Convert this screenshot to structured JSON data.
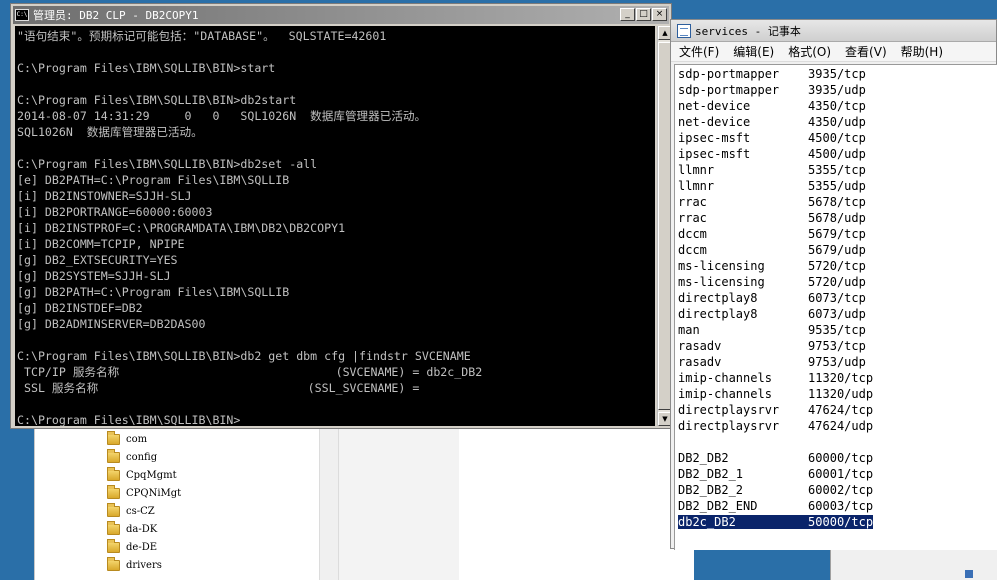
{
  "explorer": {
    "folders": [
      "com",
      "config",
      "CpqMgmt",
      "CPQNiMgt",
      "cs-CZ",
      "da-DK",
      "de-DE",
      "drivers"
    ]
  },
  "console": {
    "title": "管理员: DB2 CLP - DB2COPY1",
    "lines": [
      "\"语句结束\"。预期标记可能包括：\"DATABASE\"。  SQLSTATE=42601",
      "",
      "C:\\Program Files\\IBM\\SQLLIB\\BIN>start",
      "",
      "C:\\Program Files\\IBM\\SQLLIB\\BIN>db2start",
      "2014-08-07 14:31:29     0   0   SQL1026N  数据库管理器已活动。",
      "SQL1026N  数据库管理器已活动。",
      "",
      "C:\\Program Files\\IBM\\SQLLIB\\BIN>db2set -all",
      "[e] DB2PATH=C:\\Program Files\\IBM\\SQLLIB",
      "[i] DB2INSTOWNER=SJJH-SLJ",
      "[i] DB2PORTRANGE=60000:60003",
      "[i] DB2INSTPROF=C:\\PROGRAMDATA\\IBM\\DB2\\DB2COPY1",
      "[i] DB2COMM=TCPIP, NPIPE",
      "[g] DB2_EXTSECURITY=YES",
      "[g] DB2SYSTEM=SJJH-SLJ",
      "[g] DB2PATH=C:\\Program Files\\IBM\\SQLLIB",
      "[g] DB2INSTDEF=DB2",
      "[g] DB2ADMINSERVER=DB2DAS00",
      "",
      "C:\\Program Files\\IBM\\SQLLIB\\BIN>db2 get dbm cfg |findstr SVCENAME",
      " TCP/IP 服务名称                               (SVCENAME) = db2c_DB2",
      " SSL 服务名称                              (SSL_SVCENAME) =",
      "",
      "C:\\Program Files\\IBM\\SQLLIB\\BIN>"
    ]
  },
  "notepad": {
    "title": "services - 记事本",
    "menu": [
      "文件(F)",
      "编辑(E)",
      "格式(O)",
      "查看(V)",
      "帮助(H)"
    ],
    "lines": [
      "sdp-portmapper    3935/tcp",
      "sdp-portmapper    3935/udp",
      "net-device        4350/tcp",
      "net-device        4350/udp",
      "ipsec-msft        4500/tcp",
      "ipsec-msft        4500/udp",
      "llmnr             5355/tcp",
      "llmnr             5355/udp",
      "rrac              5678/tcp",
      "rrac              5678/udp",
      "dccm              5679/tcp",
      "dccm              5679/udp",
      "ms-licensing      5720/tcp",
      "ms-licensing      5720/udp",
      "directplay8       6073/tcp",
      "directplay8       6073/udp",
      "man               9535/tcp",
      "rasadv            9753/tcp",
      "rasadv            9753/udp",
      "imip-channels     11320/tcp",
      "imip-channels     11320/udp",
      "directplaysrvr    47624/tcp",
      "directplaysrvr    47624/udp",
      "",
      "DB2_DB2           60000/tcp",
      "DB2_DB2_1         60001/tcp",
      "DB2_DB2_2         60002/tcp",
      "DB2_DB2_END       60003/tcp"
    ],
    "selected_line": "db2c_DB2          50000/tcp"
  },
  "colors": {
    "desktop": "#2a6fa8",
    "console_bg": "#000000",
    "console_text": "#c0c0c0",
    "selection": "#0a246a"
  }
}
